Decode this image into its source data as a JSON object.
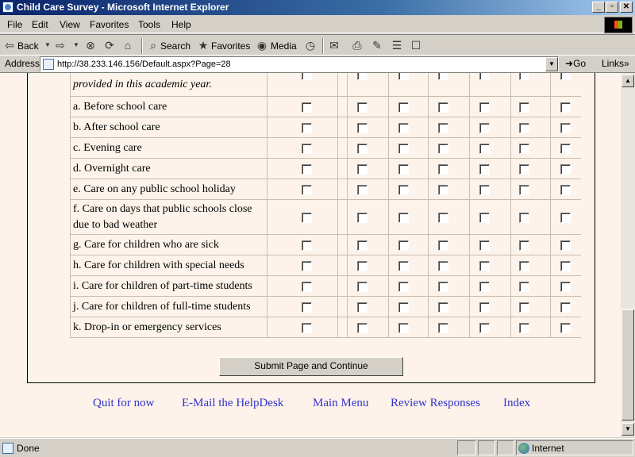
{
  "window": {
    "title": "Child Care Survey - Microsoft Internet Explorer",
    "min": "_",
    "restore": "▫",
    "close": "✕"
  },
  "menu": [
    "File",
    "Edit",
    "View",
    "Favorites",
    "Tools",
    "Help"
  ],
  "toolbar": {
    "back": "Back",
    "search": "Search",
    "favorites": "Favorites",
    "media": "Media"
  },
  "address": {
    "label": "Address",
    "url": "http://38.233.146.156/Default.aspx?Page=28",
    "go": "Go",
    "links": "Links"
  },
  "survey": {
    "partial_prompt": "provided in this academic year.",
    "items": [
      "a. Before school care",
      "b. After school care",
      "c. Evening care",
      "d. Overnight care",
      "e. Care on any public school holiday",
      "f. Care on days that public schools close due to bad weather",
      "g. Care for children who are sick",
      "h. Care for children with special needs",
      "i. Care for children of part-time students",
      "j. Care for children of full-time students",
      "k. Drop-in or emergency services"
    ],
    "submit": "Submit Page and Continue"
  },
  "footer": {
    "links": [
      "Quit for now",
      "E-Mail the HelpDesk",
      "Main Menu",
      "Review Responses",
      "Index"
    ]
  },
  "status": {
    "text": "Done",
    "zone": "Internet"
  },
  "colors": {
    "content_bg": "#fdf3ea",
    "link": "#3333cc",
    "titlebar": "#0a246a"
  }
}
